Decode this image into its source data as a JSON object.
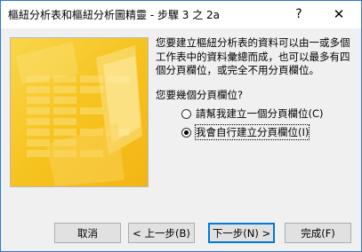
{
  "window": {
    "title": "樞紐分析表和樞紐分析圖精靈 - 步驟 3 之 2a",
    "help_glyph": "?",
    "close_glyph": "✕"
  },
  "wizard": {
    "instructions": "您要建立樞紐分析表的資料可以由一或多個工作表中的資料彙總而成，也可以最多有四個分頁欄位，或完全不用分頁欄位。",
    "question": "您要幾個分頁欄位?",
    "options": [
      {
        "label": "請幫我建立一個分頁欄位(C)",
        "checked": false
      },
      {
        "label": "我會自行建立分頁欄位(I)",
        "checked": true
      }
    ]
  },
  "buttons": {
    "cancel": "取消",
    "back": "< 上一步(B)",
    "next": "下一步(N) >",
    "finish": "完成(F)"
  },
  "colors": {
    "accent": "#0078d7",
    "image_yellow": "#f7c21c"
  }
}
